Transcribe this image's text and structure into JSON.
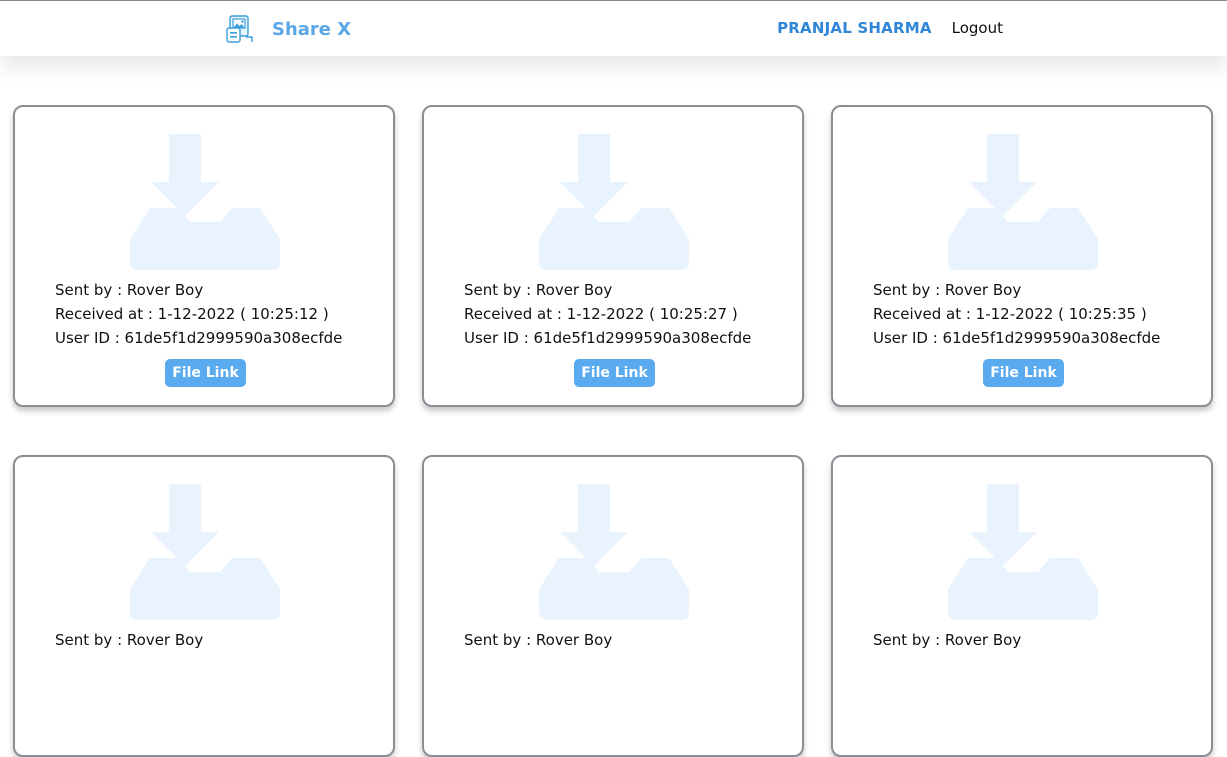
{
  "app": {
    "brand": "Share X",
    "brand_color": "#5aa6e8",
    "accent": "#5aaaf0"
  },
  "nav": {
    "user_name": "PRANJAL SHARMA",
    "logout_label": "Logout"
  },
  "icons": {
    "brand": "share-logo-icon",
    "card": "download-tray-icon"
  },
  "cards": [
    {
      "sent_label": "Sent by : Rover Boy",
      "received_label": "Received at : 1-12-2022 ( 10:25:12 )",
      "user_label": "User ID : 61de5f1d2999590a308ecfde",
      "button_label": "File Link"
    },
    {
      "sent_label": "Sent by : Rover Boy",
      "received_label": "Received at : 1-12-2022 ( 10:25:27 )",
      "user_label": "User ID : 61de5f1d2999590a308ecfde",
      "button_label": "File Link"
    },
    {
      "sent_label": "Sent by : Rover Boy",
      "received_label": "Received at : 1-12-2022 ( 10:25:35 )",
      "user_label": "User ID : 61de5f1d2999590a308ecfde",
      "button_label": "File Link"
    },
    {
      "sent_label": "Sent by : Rover Boy"
    },
    {
      "sent_label": "Sent by : Rover Boy"
    },
    {
      "sent_label": "Sent by : Rover Boy"
    }
  ]
}
